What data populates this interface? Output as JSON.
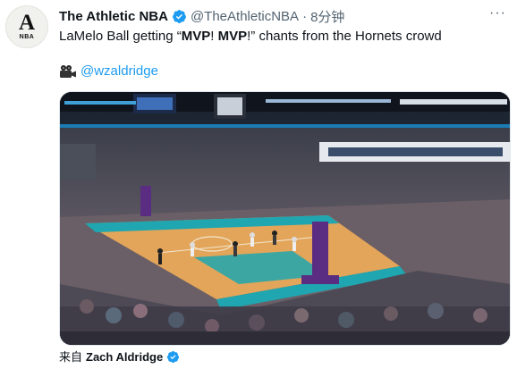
{
  "tweet": {
    "display_name": "The Athletic NBA",
    "handle": "@TheAthleticNBA",
    "separator": "·",
    "time": "8分钟",
    "text_prefix": "LaMelo Ball getting “",
    "text_bold1": "MVP",
    "text_mid": "! ",
    "text_bold2": "MVP",
    "text_suffix": "!” chants from the Hornets crowd",
    "credit_handle": "@wzaldridge",
    "via_label": "来自",
    "via_name": "Zach Aldridge"
  },
  "avatar": {
    "glyph": "A",
    "sub": "NBA"
  },
  "more_icon": "···",
  "icons": {
    "verified": "verified-badge-icon",
    "camera": "video-camera-icon",
    "more": "more-options-icon"
  },
  "colors": {
    "link": "#1d9bf0",
    "verified": "#1d9bf0",
    "court": "#e5a65a",
    "teal": "#1fa6b0",
    "purple": "#5a2d82"
  }
}
